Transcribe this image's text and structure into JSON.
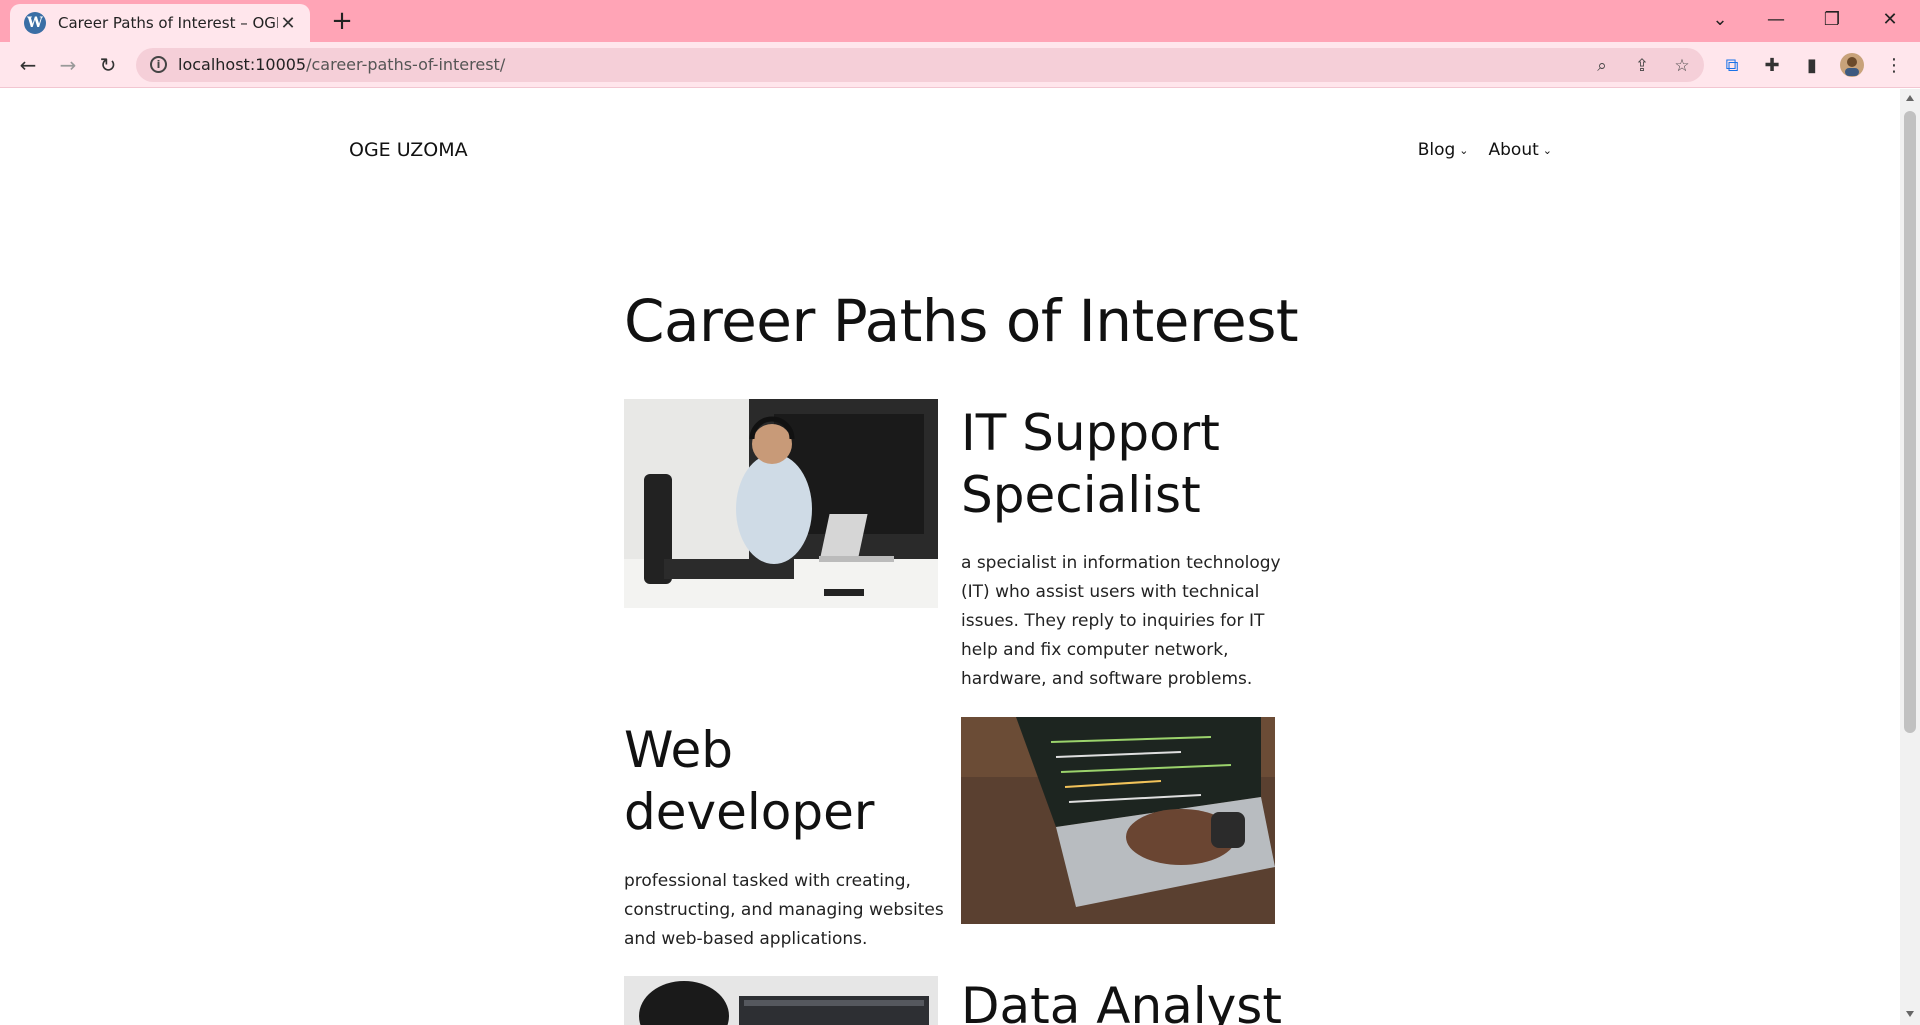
{
  "browser": {
    "tab_title": "Career Paths of Interest – OGE UZOMA",
    "new_tab_label": "+",
    "url_host": "localhost:10005",
    "url_path": "/career-paths-of-interest/",
    "icons": [
      "wordpress-icon",
      "close-icon",
      "back-icon",
      "forward-icon",
      "reload-icon",
      "info-icon",
      "zoom-icon",
      "share-icon",
      "star-icon",
      "extension-icon",
      "puzzle-icon",
      "sidepanel-icon",
      "profile-avatar",
      "menu-icon"
    ]
  },
  "site": {
    "title": "OGE UZOMA",
    "nav": [
      {
        "label": "Blog"
      },
      {
        "label": "About"
      }
    ]
  },
  "page": {
    "title": "Career Paths of Interest",
    "careers": [
      {
        "heading_line1": "IT Support",
        "heading_line2": "Specialist",
        "description": "a specialist in information technology (IT) who assist users with technical issues. They reply to inquiries for IT help and fix computer network, hardware, and software problems."
      },
      {
        "heading_line1": "Web",
        "heading_line2": "developer",
        "description": "professional tasked with creating, constructing, and managing websites and web-based applications."
      },
      {
        "heading_line1": "Data Analyst",
        "heading_line2": "",
        "description": ""
      }
    ]
  },
  "colors": {
    "tabstrip": "#ffa4b6",
    "toolbar": "#ffe6ec",
    "omnibox": "#f5cfd8"
  }
}
